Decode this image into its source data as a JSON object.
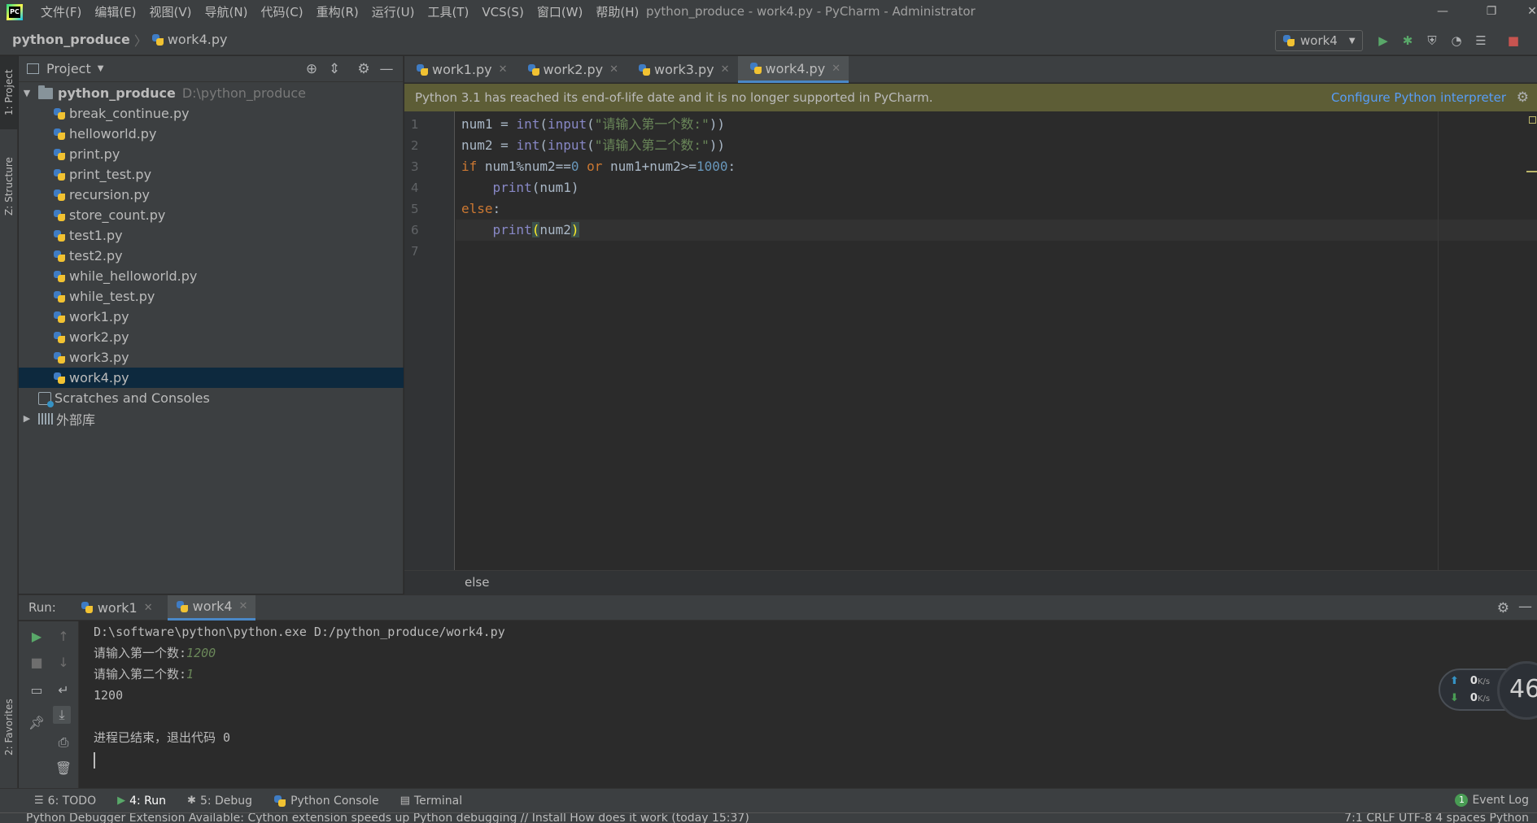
{
  "titlebar": {
    "menu": [
      "文件(F)",
      "编辑(E)",
      "视图(V)",
      "导航(N)",
      "代码(C)",
      "重构(R)",
      "运行(U)",
      "工具(T)",
      "VCS(S)",
      "窗口(W)",
      "帮助(H)"
    ],
    "window_title": "python_produce - work4.py - PyCharm - Administrator"
  },
  "navbar": {
    "project": "python_produce",
    "file": "work4.py",
    "run_config": "work4"
  },
  "left_stripe": {
    "project_tab": "1: Project",
    "structure_tab": "Z: Structure",
    "favorites_tab": "2: Favorites"
  },
  "project_panel": {
    "title": "Project",
    "root_name": "python_produce",
    "root_path": "D:\\python_produce",
    "files": [
      "break_continue.py",
      "helloworld.py",
      "print.py",
      "print_test.py",
      "recursion.py",
      "store_count.py",
      "test1.py",
      "test2.py",
      "while_helloworld.py",
      "while_test.py",
      "work1.py",
      "work2.py",
      "work3.py",
      "work4.py"
    ],
    "selected_file": "work4.py",
    "scratches": "Scratches and Consoles",
    "external_libs": "外部库"
  },
  "editor": {
    "tabs": [
      "work1.py",
      "work2.py",
      "work3.py",
      "work4.py"
    ],
    "active_tab": "work4.py",
    "banner_text": "Python 3.1 has reached its end-of-life date and it is no longer supported in PyCharm.",
    "banner_link": "Configure Python interpreter",
    "line_numbers": [
      "1",
      "2",
      "3",
      "4",
      "5",
      "6",
      "7"
    ],
    "code_lines": [
      "num1 = int(input(\"请输入第一个数:\"))",
      "num2 = int(input(\"请输入第二个数:\"))",
      "if num1%num2==0 or num1+num2>=1000:",
      "    print(num1)",
      "else:",
      "    print(num2)",
      ""
    ],
    "breadcrumb": "else"
  },
  "run_panel": {
    "label": "Run:",
    "tabs": [
      "work1",
      "work4"
    ],
    "active_tab": "work4",
    "console": {
      "command": "D:\\software\\python\\python.exe D:/python_produce/work4.py",
      "prompt1": "请输入第一个数:",
      "input1": "1200",
      "prompt2": "请输入第二个数:",
      "input2": "1",
      "output": "1200",
      "exit_msg": "进程已结束，退出代码 0"
    }
  },
  "net_widget": {
    "up_value": "0",
    "down_value": "0",
    "unit": "K/s",
    "gauge": "46"
  },
  "bottom_tabs": {
    "todo": "6: TODO",
    "run": "4: Run",
    "debug": "5: Debug",
    "python_console": "Python Console",
    "terminal": "Terminal",
    "event_log": "Event Log",
    "event_log_count": "1"
  },
  "statusbar": {
    "message": "Python Debugger Extension Available: Cython extension speeds up Python debugging // Install   How does it work (today 15:37)",
    "right": "7:1   CRLF   UTF-8   4 spaces   Python"
  },
  "colors": {
    "background": "#2b2b2b",
    "panel": "#3c3f41",
    "selection": "#0d293e",
    "banner": "#5d5d36",
    "accent": "#4a88c7",
    "keyword": "#cc7832",
    "string": "#6a8759",
    "number": "#6897bb",
    "builtin": "#8888c6"
  }
}
